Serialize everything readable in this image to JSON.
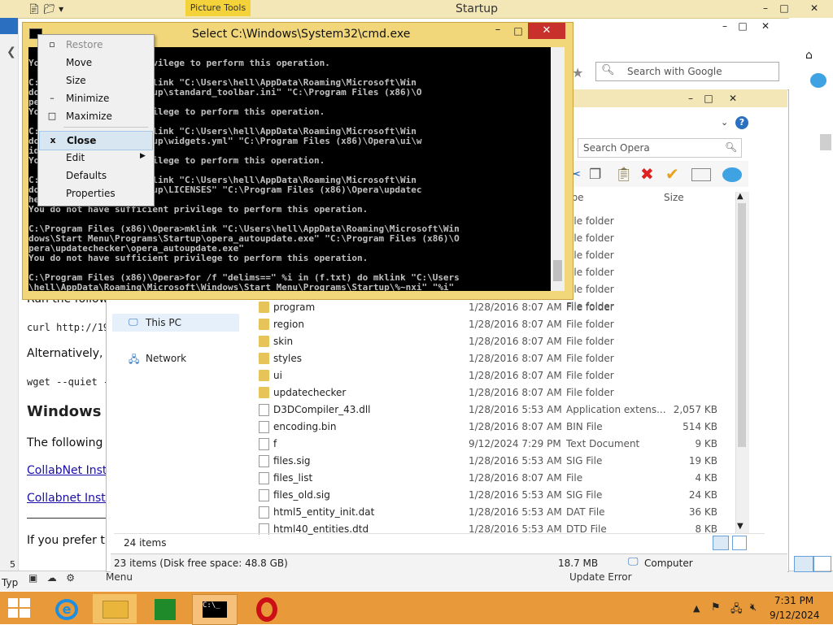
{
  "top_window": {
    "title": "Startup",
    "ribbon_context": "Picture Tools",
    "controls": [
      "–",
      "□",
      "✕"
    ]
  },
  "browser": {
    "search_placeholder": "Search with Google",
    "fragments": {
      "run_line": "Run the follow",
      "curl": "curl http://19",
      "alt": "Alternatively, it",
      "wget": "wget --quiet -",
      "windows_heading": "Windows",
      "following": "The following e",
      "link1": "CollabNet Inst",
      "link2": "Collabnet Insta",
      "prefer": "If you prefer th",
      "status_left": "Typ",
      "menu": "Menu",
      "update_error": "Update Error",
      "sidebar_num": "5"
    }
  },
  "explorer": {
    "search_placeholder": "Search Opera",
    "col_type": "Type",
    "col_size": "Size",
    "nav": [
      {
        "label": "This PC",
        "icon": "pc-icon"
      },
      {
        "label": "Network",
        "icon": "network-icon"
      }
    ],
    "partial_rows": [
      {
        "type": "File folder"
      },
      {
        "type": "File folder"
      },
      {
        "type": "File folder"
      },
      {
        "type": "File folder"
      },
      {
        "type": "File folder"
      },
      {
        "type": "File folder"
      }
    ],
    "rows": [
      {
        "name": "program",
        "date": "1/28/2016 8:07 AM",
        "type": "File folder",
        "size": "",
        "kind": "folder"
      },
      {
        "name": "region",
        "date": "1/28/2016 8:07 AM",
        "type": "File folder",
        "size": "",
        "kind": "folder"
      },
      {
        "name": "skin",
        "date": "1/28/2016 8:07 AM",
        "type": "File folder",
        "size": "",
        "kind": "folder"
      },
      {
        "name": "styles",
        "date": "1/28/2016 8:07 AM",
        "type": "File folder",
        "size": "",
        "kind": "folder"
      },
      {
        "name": "ui",
        "date": "1/28/2016 8:07 AM",
        "type": "File folder",
        "size": "",
        "kind": "folder"
      },
      {
        "name": "updatechecker",
        "date": "1/28/2016 8:07 AM",
        "type": "File folder",
        "size": "",
        "kind": "folder"
      },
      {
        "name": "D3DCompiler_43.dll",
        "date": "1/28/2016 5:53 AM",
        "type": "Application extens...",
        "size": "2,057 KB",
        "kind": "file"
      },
      {
        "name": "encoding.bin",
        "date": "1/28/2016 8:07 AM",
        "type": "BIN File",
        "size": "514 KB",
        "kind": "file"
      },
      {
        "name": "f",
        "date": "9/12/2024 7:29 PM",
        "type": "Text Document",
        "size": "9 KB",
        "kind": "file"
      },
      {
        "name": "files.sig",
        "date": "1/28/2016 5:53 AM",
        "type": "SIG File",
        "size": "19 KB",
        "kind": "file"
      },
      {
        "name": "files_list",
        "date": "1/28/2016 8:07 AM",
        "type": "File",
        "size": "4 KB",
        "kind": "file"
      },
      {
        "name": "files_old.sig",
        "date": "1/28/2016 5:53 AM",
        "type": "SIG File",
        "size": "24 KB",
        "kind": "file"
      },
      {
        "name": "html5_entity_init.dat",
        "date": "1/28/2016 5:53 AM",
        "type": "DAT File",
        "size": "36 KB",
        "kind": "file"
      },
      {
        "name": "html40_entities.dtd",
        "date": "1/28/2016 5:53 AM",
        "type": "DTD File",
        "size": "8 KB",
        "kind": "file"
      }
    ],
    "item_count": "24 items",
    "status_items": "23 items (Disk free space: 48.8 GB)",
    "status_size": "18.7 MB",
    "status_location": "Computer"
  },
  "cmd": {
    "title": "Select C:\\Windows\\System32\\cmd.exe",
    "lines": [
      "                 ),\\e.ini\"",
      "Yo       sufficient privilege to perform this operation.",
      "",
      "C:        x86)\\Opera>mklink \"C:\\Users\\hell\\AppData\\Roaming\\Microsoft\\Win",
      "do        rograms\\Startup\\standard_toolbar.ini\" \"C:\\Program Files (x86)\\O",
      "pe        olbar.ini\"",
      "Yo        fficient privilege to perform this operation.",
      "",
      "C:        x86)\\Opera>mklink \"C:\\Users\\hell\\AppData\\Roaming\\Microsoft\\Win",
      "do        rograms\\Startup\\widgets.yml\" \"C:\\Program Files (x86)\\Opera\\ui\\w",
      "id",
      "Yo        fficient privilege to perform this operation.",
      "",
      "C:        x86)\\Opera>mklink \"C:\\Users\\hell\\AppData\\Roaming\\Microsoft\\Win",
      "do        rograms\\Startup\\LICENSES\" \"C:\\Program Files (x86)\\Opera\\updatec",
      "he",
      "You do not have sufficient privilege to perform this operation.",
      "",
      "C:\\Program Files (x86)\\Opera>mklink \"C:\\Users\\hell\\AppData\\Roaming\\Microsoft\\Win",
      "dows\\Start Menu\\Programs\\Startup\\opera_autoupdate.exe\" \"C:\\Program Files (x86)\\O",
      "pera\\updatechecker\\opera_autoupdate.exe\"",
      "You do not have sufficient privilege to perform this operation.",
      "",
      "C:\\Program Files (x86)\\Opera>for /f \"delims==\" %i in (f.txt) do mklink \"C:\\Users",
      "\\hell\\AppData\\Roaming\\Microsoft\\Windows\\Start Menu\\Programs\\Startup\\%~nxi\" \"%i\""
    ]
  },
  "context_menu": {
    "items": [
      {
        "label": "Restore",
        "glyph": "▫",
        "disabled": true
      },
      {
        "label": "Move",
        "glyph": "",
        "disabled": false
      },
      {
        "label": "Size",
        "glyph": "",
        "disabled": false
      },
      {
        "label": "Minimize",
        "glyph": "–",
        "disabled": false
      },
      {
        "label": "Maximize",
        "glyph": "□",
        "disabled": false
      },
      {
        "label": "Close",
        "glyph": "x",
        "disabled": false
      },
      {
        "label": "Edit",
        "glyph": "",
        "disabled": false
      },
      {
        "label": "Defaults",
        "glyph": "",
        "disabled": false
      },
      {
        "label": "Properties",
        "glyph": "",
        "disabled": false
      }
    ]
  },
  "taskbar": {
    "time": "7:31 PM",
    "date": "9/12/2024",
    "colors": {
      "taskbar": "#e89a3a",
      "opera": "#cc0f16",
      "cmd_close": "#c7302b"
    }
  }
}
